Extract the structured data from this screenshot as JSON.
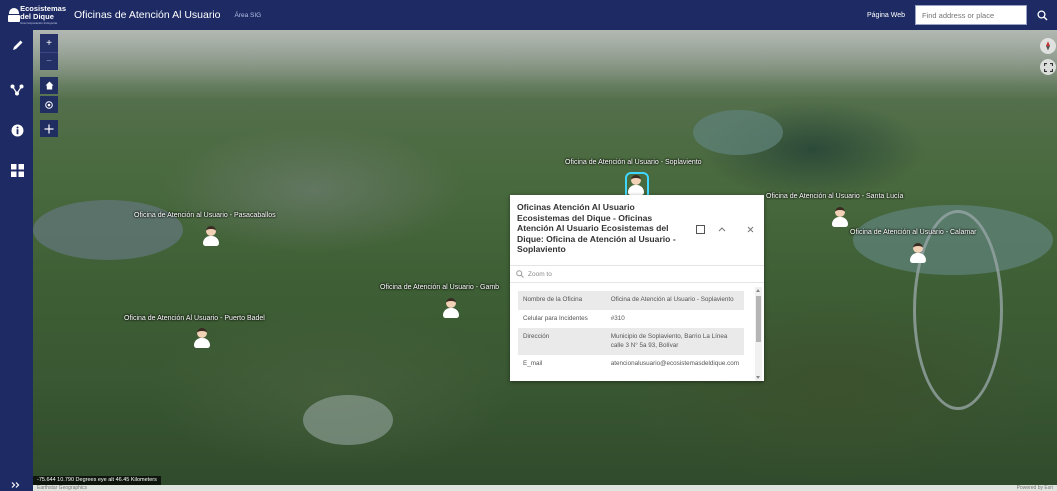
{
  "header": {
    "logo_line1": "Ecosistemas",
    "logo_line2": "del Dique",
    "logo_tagline": "Una Corporación Incluyente",
    "title": "Oficinas de Atención Al Usuario",
    "subtitle": "Área SIG",
    "web_link": "Página Web",
    "search_placeholder": "Find address or place"
  },
  "zoom": {
    "in": "+",
    "out": "−"
  },
  "points": [
    {
      "label": "Oficina de Atención al Usuario - Soplaviento"
    },
    {
      "label": "Oficina de Atención al Usuario - Pasacaballos"
    },
    {
      "label": "Oficina de Atención al Usuario - Santa Lucía"
    },
    {
      "label": "Oficina de Atención al Usuario - Calamar"
    },
    {
      "label": "Oficina de Atención al Usuario - Gamb"
    },
    {
      "label": "Oficina de Atención Al Usuario - Puerto Badel"
    }
  ],
  "popup": {
    "title": "Oficinas Atención Al Usuario Ecosistemas del Dique - Oficinas Atención Al Usuario Ecosistemas del Dique: Oficina de Atención al Usuario - Soplaviento",
    "zoom_to": "Zoom to",
    "rows": [
      {
        "field": "Nombre de la Oficina",
        "value": "Oficina de Atención al Usuario - Soplaviento"
      },
      {
        "field": "Celular para Incidentes",
        "value": "#310"
      },
      {
        "field": "Dirección",
        "value": "Municipio de Soplaviento, Barrio La Línea calle 3 N° 5a 93, Bolívar"
      },
      {
        "field": "E_mail",
        "value": "atencionalusuario@ecosistemasdeldique.com"
      }
    ]
  },
  "footer": {
    "coords": "-75.644 10.790 Degrees  eye alt 46.45 Kilometers",
    "attribution": "Earthstar Geographics",
    "powered": "Powered by Esri"
  },
  "colors": {
    "header_bg": "#1d2a63",
    "accent": "#3fd7ff"
  }
}
